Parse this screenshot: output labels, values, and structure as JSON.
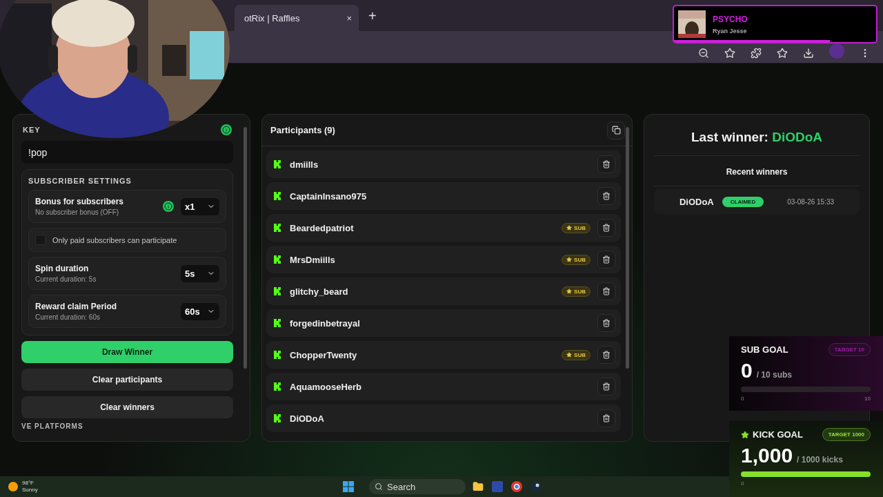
{
  "browser": {
    "tab": {
      "title": "otRix | Raffles",
      "close": "×"
    },
    "new_tab": "+"
  },
  "now_playing": {
    "title": "PSYCHO",
    "artist": "Ryan Jesse",
    "level": 0.77
  },
  "settings_panel": {
    "key_label": "KEY",
    "keyword": "!pop",
    "subscriber_settings": {
      "title": "SUBSCRIBER SETTINGS",
      "rows": [
        {
          "kind": "select",
          "title": "Bonus for subscribers",
          "subtitle": "No subscriber bonus (OFF)",
          "value": "x1",
          "info": true
        },
        {
          "kind": "checkbox",
          "title": "Only paid subscribers can participate",
          "checked": false
        },
        {
          "kind": "select",
          "title": "Spin duration",
          "subtitle": "Current duration: 5s",
          "value": "5s"
        },
        {
          "kind": "select",
          "title": "Reward claim Period",
          "subtitle": "Current duration: 60s",
          "value": "60s"
        }
      ]
    },
    "buttons": [
      {
        "label": "Draw Winner",
        "kind": "primary"
      },
      {
        "label": "Clear participants",
        "kind": "secondary"
      },
      {
        "label": "Clear winners",
        "kind": "secondary"
      }
    ],
    "next_section": "VE PLATFORMS"
  },
  "participants": {
    "title": "Participants (9)",
    "items": [
      {
        "name": "dmiills"
      },
      {
        "name": "CaptainInsano975"
      },
      {
        "name": "Beardedpatriot",
        "badge": "SUB"
      },
      {
        "name": "MrsDmiills",
        "badge": "SUB"
      },
      {
        "name": "glitchy_beard",
        "badge": "SUB"
      },
      {
        "name": "forgedinbetrayal"
      },
      {
        "name": "ChopperTwenty",
        "badge": "SUB"
      },
      {
        "name": "AquamooseHerb"
      },
      {
        "name": "DiODoA"
      }
    ]
  },
  "winners": {
    "last_label": "Last winner:",
    "last_name": "DiODoA",
    "recent_title": "Recent winners",
    "items": [
      {
        "name": "DiODoA",
        "status": "CLAIMED",
        "time": "03-08-26 15:33"
      }
    ]
  },
  "sub_goal": {
    "title": "SUB GOAL",
    "target": "TARGET 10",
    "value": "0",
    "unit": "/ 10 subs",
    "level": 0,
    "min": "0",
    "max": "10"
  },
  "kick_goal": {
    "title": "KICK GOAL",
    "target": "TARGET 1000",
    "value": "1,000",
    "unit": "/ 1000 kicks",
    "level": 1,
    "min": "0"
  },
  "taskbar": {
    "weather": {
      "temp": "98°F",
      "condition": "Sunny"
    },
    "search": "Search"
  }
}
